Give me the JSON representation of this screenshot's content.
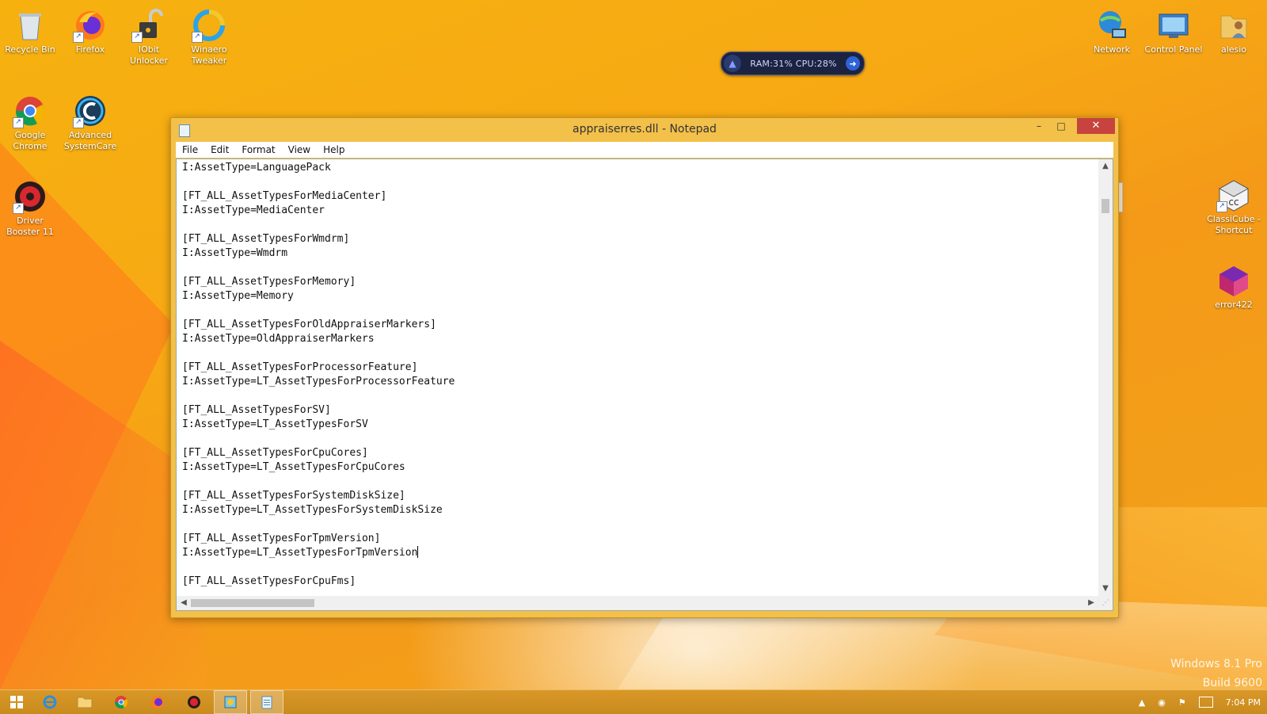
{
  "desktop": {
    "icons_left": [
      {
        "label": "Recycle Bin"
      },
      {
        "label": "Firefox"
      },
      {
        "label": "IObit Unlocker"
      },
      {
        "label": "Winaero Tweaker"
      },
      {
        "label": "Google Chrome"
      },
      {
        "label": "Advanced SystemCare"
      },
      {
        "label": "Driver Booster 11"
      }
    ],
    "icons_right": [
      {
        "label": "Network"
      },
      {
        "label": "Control Panel"
      },
      {
        "label": "alesio"
      },
      {
        "label": "ClassiCube - Shortcut"
      },
      {
        "label": "error422"
      }
    ],
    "widget": {
      "text": "RAM:31%  CPU:28%"
    },
    "watermark": {
      "line1": "Windows 8.1 Pro",
      "line2": "Build 9600"
    }
  },
  "notepad": {
    "title": "appraiserres.dll - Notepad",
    "controls": {
      "minimize": "–",
      "maximize": "□",
      "close": "✕"
    },
    "menu": [
      "File",
      "Edit",
      "Format",
      "View",
      "Help"
    ],
    "lines": [
      "I:AssetType=LanguagePack",
      "",
      "[FT_ALL_AssetTypesForMediaCenter]",
      "I:AssetType=MediaCenter",
      "",
      "[FT_ALL_AssetTypesForWmdrm]",
      "I:AssetType=Wmdrm",
      "",
      "[FT_ALL_AssetTypesForMemory]",
      "I:AssetType=Memory",
      "",
      "[FT_ALL_AssetTypesForOldAppraiserMarkers]",
      "I:AssetType=OldAppraiserMarkers",
      "",
      "[FT_ALL_AssetTypesForProcessorFeature]",
      "I:AssetType=LT_AssetTypesForProcessorFeature",
      "",
      "[FT_ALL_AssetTypesForSV]",
      "I:AssetType=LT_AssetTypesForSV",
      "",
      "[FT_ALL_AssetTypesForCpuCores]",
      "I:AssetType=LT_AssetTypesForCpuCores",
      "",
      "[FT_ALL_AssetTypesForSystemDiskSize]",
      "I:AssetType=LT_AssetTypesForSystemDiskSize",
      "",
      "[FT_ALL_AssetTypesForTpmVersion]",
      "I:AssetType=LT_AssetTypesForTpmVersion",
      "",
      "[FT_ALL_AssetTypesForCpuFms]"
    ],
    "caret_line": 27
  },
  "taskbar": {
    "items": [
      "start-icon",
      "internet-explorer-icon",
      "file-explorer-icon",
      "chrome-icon",
      "firefox-icon",
      "driver-booster-icon",
      "winaero-icon",
      "notepad-icon"
    ],
    "clock": "7:04 PM"
  }
}
